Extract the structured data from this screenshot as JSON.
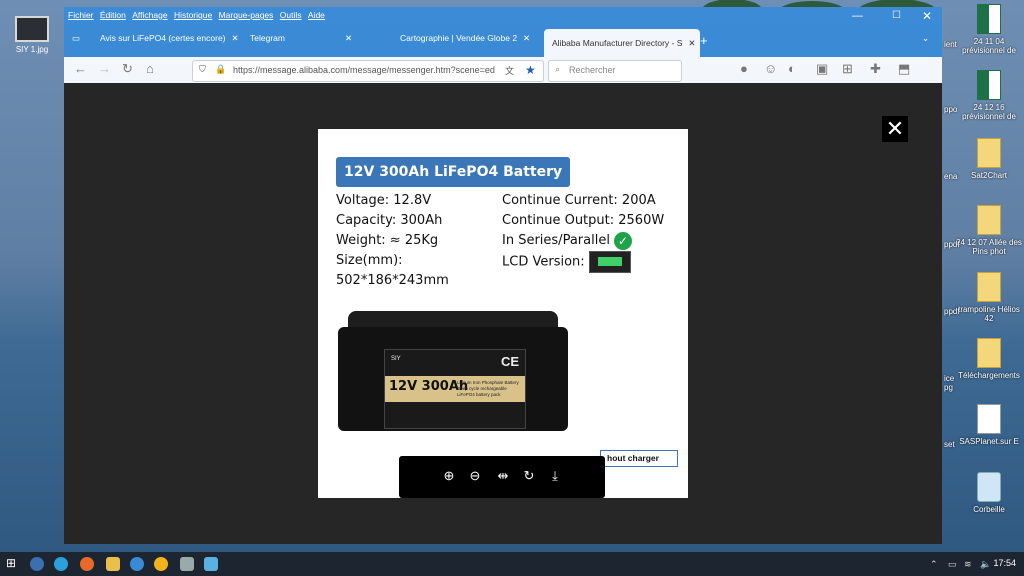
{
  "desktop": {
    "left_icon": "SIY 1.jpg",
    "icons": [
      {
        "label": "24 11 04 prévisionnel de",
        "type": "xls"
      },
      {
        "label": "24 12 16 prévisionnel de",
        "type": "xls"
      },
      {
        "label": "Sat2Chart",
        "type": "folder"
      },
      {
        "label": "24 12 07 Allée des Pins phot",
        "type": "folder"
      },
      {
        "label": "trampoline Hélios 42",
        "type": "folder"
      },
      {
        "label": "Téléchargements",
        "type": "folder"
      },
      {
        "label": "SASPlanet.sur E",
        "type": "file"
      },
      {
        "label": "Corbeille",
        "type": "bin"
      }
    ],
    "side_fragments": [
      "ient",
      "ppo",
      "ena",
      "ppdf",
      "ppdf",
      "ice pg",
      "set"
    ]
  },
  "browser": {
    "menu": [
      "Fichier",
      "Édition",
      "Affichage",
      "Historique",
      "Marque-pages",
      "Outils",
      "Aide"
    ],
    "tabs": [
      {
        "label": "Avis sur LiFePO4 (certes encore)",
        "active": false
      },
      {
        "label": "Telegram",
        "active": false
      },
      {
        "label": "Cartographie | Vendée Globe 2",
        "active": false
      },
      {
        "label": "Alibaba Manufacturer Directory - S",
        "active": true
      }
    ],
    "url": "https://message.alibaba.com/message/messenger.htm?scene=ed",
    "search_placeholder": "Rechercher"
  },
  "product": {
    "title": "12V 300Ah LiFePO4 Battery",
    "left_specs": [
      "Voltage: 12.8V",
      "Capacity: 300Ah",
      "Weight: ≈ 25Kg",
      "Size(mm):",
      "502*186*243mm"
    ],
    "right_specs": [
      "Continue Current: 200A",
      "Continue Output: 2560W",
      "In Series/Parallel",
      "LCD Version:"
    ],
    "battery_label_big": "12V 300Ah",
    "battery_label_sub": "Lithium Iron Phosphate Battery",
    "battery_label_small": "Deep cycle rechargeable LiFePO4 battery pack",
    "battery_brand": "SIY",
    "battery_ce": "CE",
    "charger_text": "hout charger"
  },
  "taskbar": {
    "time": "17:54"
  }
}
